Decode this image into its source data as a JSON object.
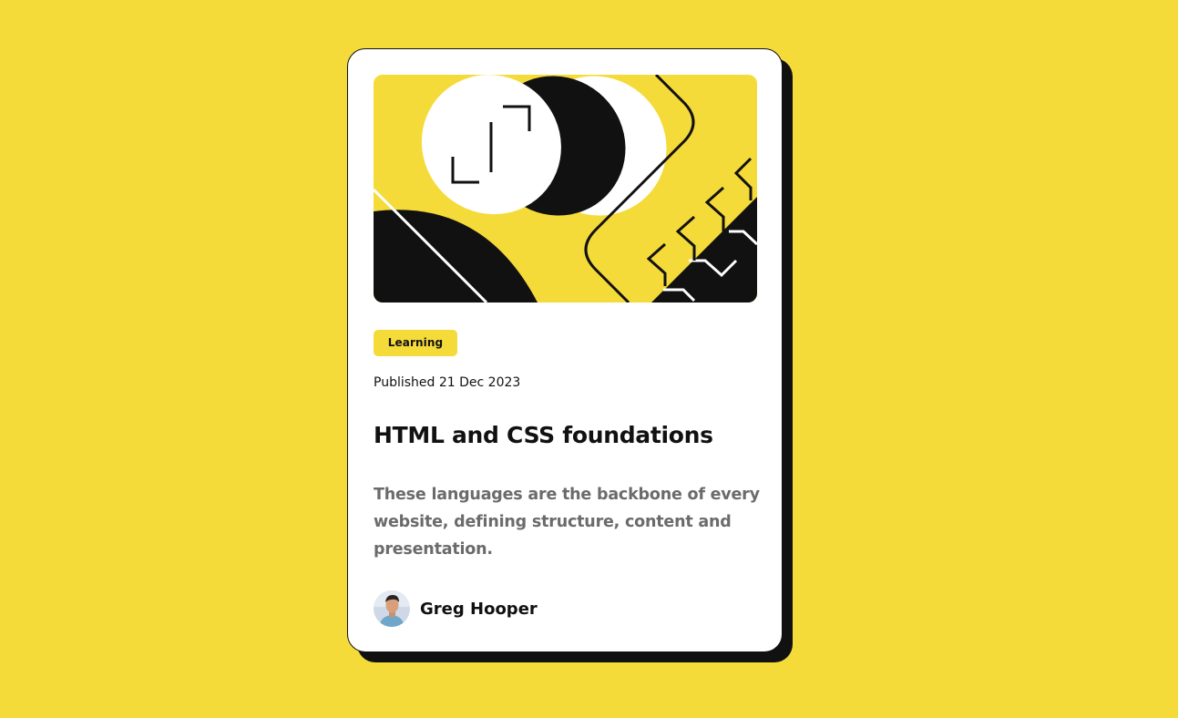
{
  "card": {
    "illustration_icon": "code-brackets-illustration",
    "tag": "Learning",
    "published": "Published 21 Dec 2023",
    "title": "HTML and CSS foundations",
    "description": "These languages are the backbone of every website, defining structure, content and presentation.",
    "author": {
      "name": "Greg Hooper",
      "avatar_icon": "avatar-photo"
    }
  },
  "colors": {
    "background": "#f5db3a",
    "card": "#ffffff",
    "ink": "#111111",
    "muted_text": "#6b6b6b",
    "tag_background": "#f5db3a"
  }
}
